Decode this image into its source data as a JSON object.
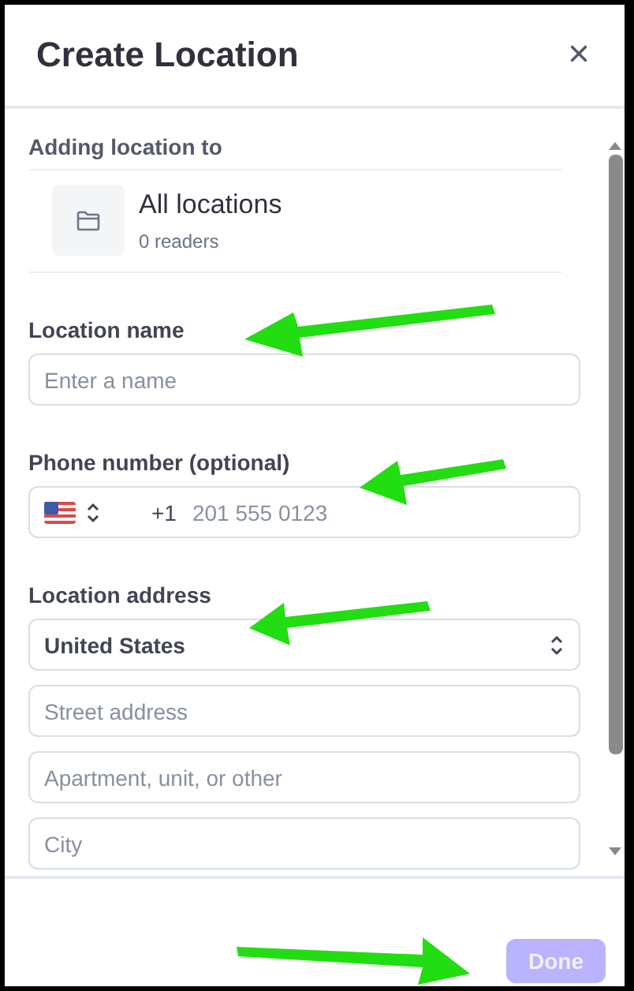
{
  "dialog": {
    "title": "Create Location",
    "close": "×"
  },
  "parent": {
    "label": "Adding location to",
    "name": "All locations",
    "readers": "0 readers"
  },
  "fields": [
    {
      "kind": "text",
      "label": "Location name",
      "placeholder": "Enter a name"
    },
    {
      "kind": "phone",
      "label": "Phone number (optional)",
      "prefix": "+1",
      "placeholder": "201 555 0123"
    },
    {
      "kind": "address",
      "label": "Location address",
      "country": "United States",
      "lines": [
        {
          "placeholder": "Street address"
        },
        {
          "placeholder": "Apartment, unit, or other"
        },
        {
          "placeholder": "City"
        }
      ]
    }
  ],
  "footer": {
    "button": "Done",
    "disabled": true
  }
}
